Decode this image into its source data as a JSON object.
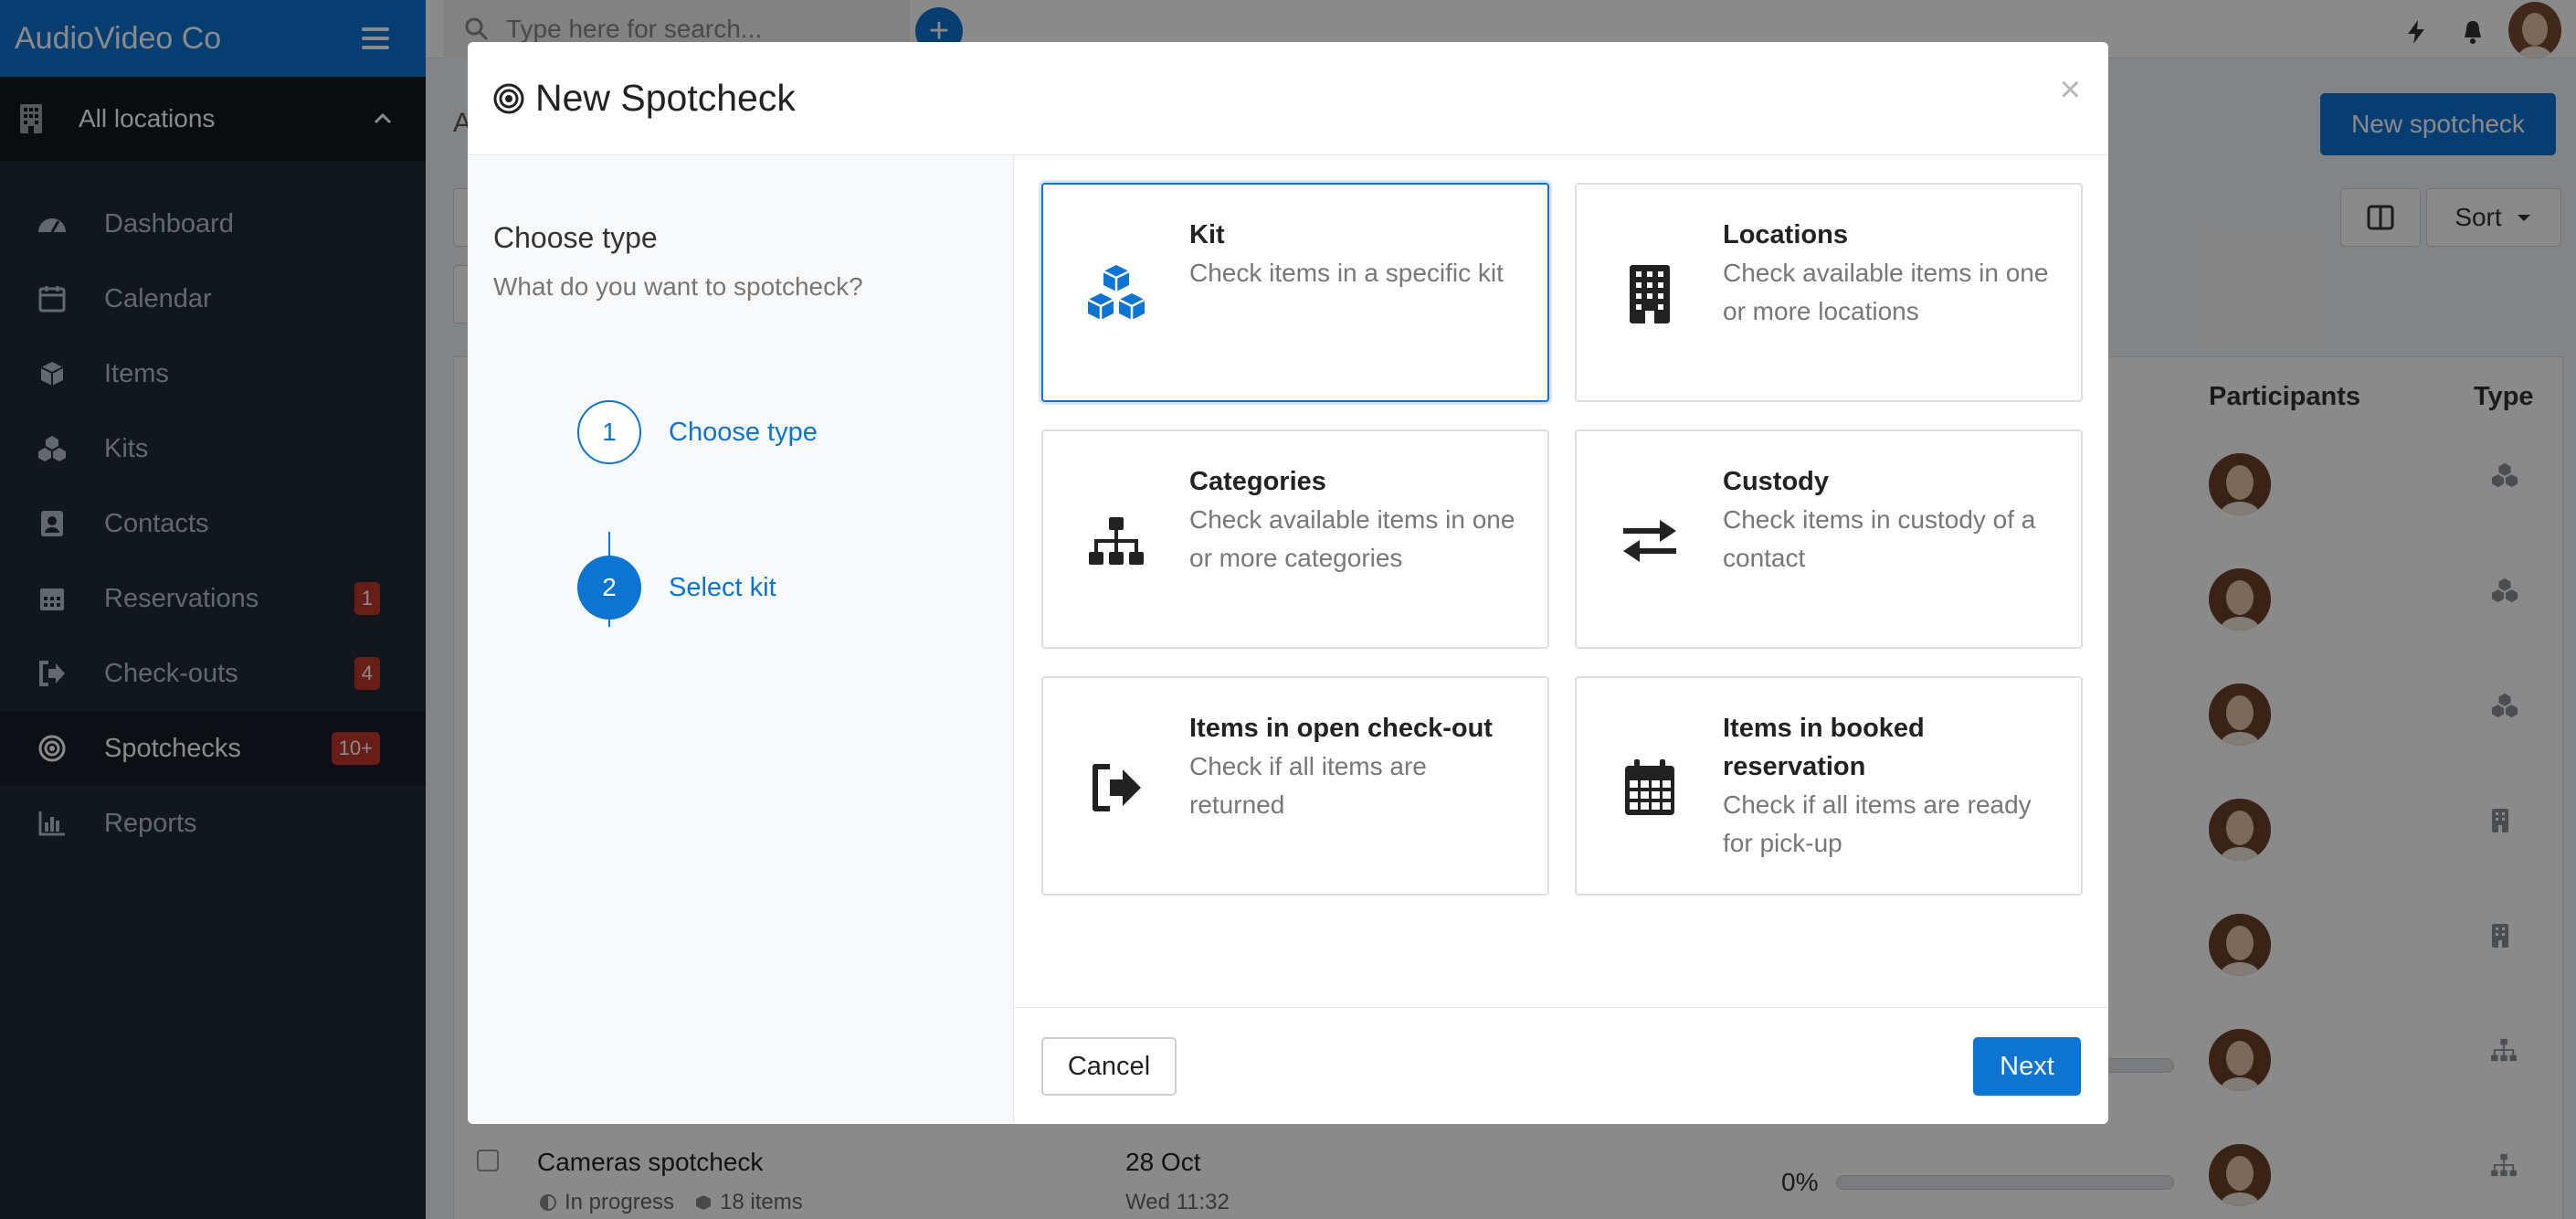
{
  "app": {
    "brand": "AudioVideo Co"
  },
  "location_selector": {
    "label": "All locations"
  },
  "sidebar": {
    "items": [
      {
        "label": "Dashboard",
        "icon": "dashboard-icon",
        "badge": ""
      },
      {
        "label": "Calendar",
        "icon": "calendar-icon",
        "badge": ""
      },
      {
        "label": "Items",
        "icon": "cube-icon",
        "badge": ""
      },
      {
        "label": "Kits",
        "icon": "cubes-icon",
        "badge": ""
      },
      {
        "label": "Contacts",
        "icon": "contact-icon",
        "badge": ""
      },
      {
        "label": "Reservations",
        "icon": "calendar-grid-icon",
        "badge": "1"
      },
      {
        "label": "Check-outs",
        "icon": "sign-out-icon",
        "badge": "4"
      },
      {
        "label": "Spotchecks",
        "icon": "target-icon",
        "badge": "10+"
      },
      {
        "label": "Reports",
        "icon": "bar-chart-icon",
        "badge": ""
      }
    ],
    "active_index": 7
  },
  "topbar": {
    "search_placeholder": "Type here for search..."
  },
  "page": {
    "breadcrumb_initial": "A",
    "new_button": "New spotcheck",
    "sort_label": "Sort",
    "columns": {
      "participants": "Participants",
      "type": "Type"
    },
    "last_row": {
      "title": "Cameras spotcheck",
      "status": "In progress",
      "items": "18 items",
      "date": "28 Oct",
      "date_sub": "Wed 11:32",
      "progress_label": "0%",
      "progress": 0
    }
  },
  "modal": {
    "title": "New Spotcheck",
    "close": "×",
    "left": {
      "heading": "Choose type",
      "subheading": "What do you want to spotcheck?"
    },
    "steps": [
      {
        "number": "1",
        "label": "Choose type",
        "state": "done"
      },
      {
        "number": "2",
        "label": "Select kit",
        "state": "current"
      }
    ],
    "cards": [
      {
        "title": "Kit",
        "desc": "Check items in a specific kit",
        "icon": "cubes-icon",
        "selected": true
      },
      {
        "title": "Locations",
        "desc": "Check available items in one or more locations",
        "icon": "building-icon",
        "selected": false
      },
      {
        "title": "Categories",
        "desc": "Check available items in one or more categories",
        "icon": "sitemap-icon",
        "selected": false
      },
      {
        "title": "Custody",
        "desc": "Check items in custody of a contact",
        "icon": "exchange-icon",
        "selected": false
      },
      {
        "title": "Items in open check-out",
        "desc": "Check if all items are returned",
        "icon": "sign-out-icon",
        "selected": false
      },
      {
        "title": "Items in booked reservation",
        "desc": "Check if all items are ready for pick-up",
        "icon": "calendar-grid-icon",
        "selected": false
      }
    ],
    "footer": {
      "cancel": "Cancel",
      "next": "Next"
    }
  },
  "colors": {
    "accent": "#0d74d1",
    "sidebar": "#212b36",
    "badge": "#c0392b"
  }
}
